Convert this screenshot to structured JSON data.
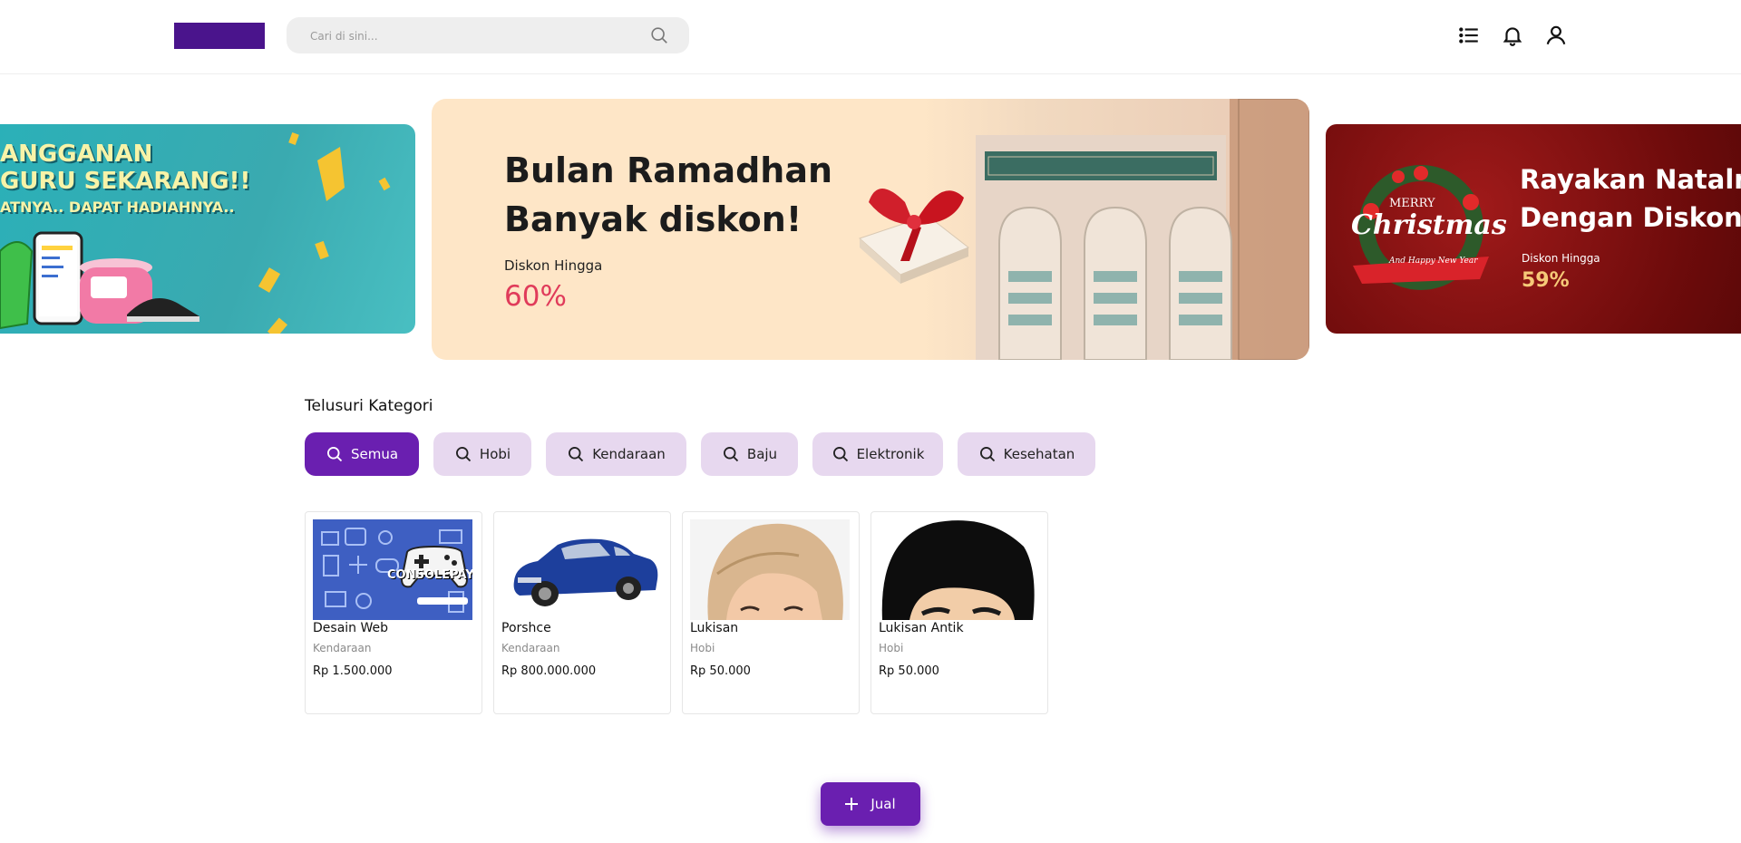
{
  "header": {
    "search_placeholder": "Cari di sini...",
    "icons": [
      "list-icon",
      "bell-icon",
      "user-icon"
    ]
  },
  "banners": {
    "left": {
      "line1": "ANGGANAN",
      "line2": "GURU SEKARANG!!",
      "line3": "ATNYA.. DAPAT HADIAHNYA.."
    },
    "center": {
      "title_line1": "Bulan Ramadhan",
      "title_line2": "Banyak diskon!",
      "discount_label": "Diskon Hingga",
      "discount_value": "60%"
    },
    "right": {
      "badge_line1": "MERRY",
      "badge_line2": "Christmas",
      "badge_line3": "And Happy New Year",
      "title_line1": "Rayakan Natalm",
      "title_line2": "Dengan Diskon J",
      "discount_label": "Diskon Hingga",
      "discount_value": "59%"
    }
  },
  "category": {
    "title": "Telusuri Kategori",
    "chips": [
      {
        "label": "Semua",
        "active": true
      },
      {
        "label": "Hobi"
      },
      {
        "label": "Kendaraan"
      },
      {
        "label": "Baju"
      },
      {
        "label": "Elektronik"
      },
      {
        "label": "Kesehatan"
      }
    ]
  },
  "products": [
    {
      "name": "Desain Web",
      "category": "Kendaraan",
      "price": "Rp 1.500.000",
      "image_text": "CONSOLEPAY"
    },
    {
      "name": "Porshce",
      "category": "Kendaraan",
      "price": "Rp 800.000.000"
    },
    {
      "name": "Lukisan",
      "category": "Hobi",
      "price": "Rp 50.000"
    },
    {
      "name": "Lukisan Antik",
      "category": "Hobi",
      "price": "Rp 50.000"
    }
  ],
  "sell_button": {
    "label": "Jual"
  },
  "colors": {
    "brand": "#6a1fb0",
    "logo": "#4a148c",
    "chip_bg": "#e7d8ef",
    "discount_red": "#e03b5a"
  }
}
